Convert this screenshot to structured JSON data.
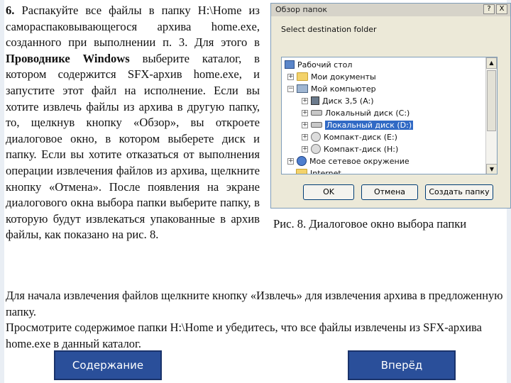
{
  "left_text": {
    "number": "6.",
    "part1": " Распакуйте все файлы в папку H:\\Home из самораспаковывающегося архива home.exe, созданного при выполнении п. 3. Для этого в ",
    "bold": "Проводнике Windows",
    "part2": " выберите каталог, в котором содержится SFX-архив home.exe, и запустите этот файл на исполнение. Если вы хотите извлечь файлы из архива в другую папку, то, щелкнув кнопку «Обзор», вы откроете диалоговое окно, в котором выберете диск и папку. Если вы хотите отказаться от выполнения операции извлечения файлов из архива, щелкните кнопку «Отмена». После появления на экране диалогового окна выбора папки выберите папку, в которую будут извлекаться упакованные в архив файлы, как показано на рис. 8."
  },
  "dialog": {
    "title": "Обзор папок",
    "help_button": "?",
    "close_button": "X",
    "instruction": "Select destination folder",
    "tree": [
      {
        "label": "Рабочий стол",
        "icon": "desktop-icon"
      },
      {
        "label": "Мои документы",
        "icon": "folder-icon"
      },
      {
        "label": "Мой компьютер",
        "icon": "computer-icon"
      },
      {
        "label": "Диск 3,5 (A:)",
        "icon": "floppy-icon"
      },
      {
        "label": "Локальный диск (C:)",
        "icon": "disk-icon"
      },
      {
        "label": "Локальный диск (D:)",
        "icon": "disk-icon",
        "selected": true
      },
      {
        "label": "Компакт-диск (E:)",
        "icon": "cd-icon"
      },
      {
        "label": "Компакт-диск (H:)",
        "icon": "cd-icon"
      },
      {
        "label": "Мое сетевое окружение",
        "icon": "network-icon"
      },
      {
        "label": "Internet",
        "icon": "folder-icon"
      }
    ],
    "buttons": {
      "ok": "OK",
      "cancel": "Отмена",
      "new_folder": "Создать папку"
    }
  },
  "caption": "Рис. 8. Диалоговое окно выбора папки",
  "bottom_text": {
    "para1": "Для начала извлечения файлов щелкните кнопку «Извлечь» для извлечения архива в предложенную папку.",
    "para2": "Просмотрите содержимое папки H:\\Home и убедитесь, что все файлы извлечены из SFX-архива home.exe в данный каталог."
  },
  "nav": {
    "contents": "Содержание",
    "next": "Вперёд"
  },
  "colors": {
    "nav_button": "#2a4f9a",
    "selection": "#316ac5"
  }
}
